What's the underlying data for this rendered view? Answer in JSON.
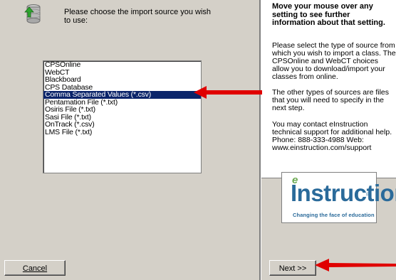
{
  "prompt": {
    "text": "Please choose the import source you wish to use:"
  },
  "source_list": {
    "items": [
      "CPSOnline",
      "WebCT",
      "Blackboard",
      "CPS Database",
      "Comma Separated Values (*.csv)",
      "Pentamation File (*.txt)",
      "Osiris File (*.txt)",
      "Sasi File (*.txt)",
      "OnTrack (*.csv)",
      "LMS File (*.txt)"
    ],
    "selected_index": 4
  },
  "info": {
    "heading": "Move your mouse over any setting to see further information about that setting.",
    "para1": "Please select the type of source from which you wish to import a class. The CPSOnline and WebCT choices allow you to download/import your classes from online.",
    "para2": "The other types of sources are files that you will need to specify in the next step.",
    "para3": "You may contact eInstruction technical support for additional help. Phone: 888-333-4988 Web: www.einstruction.com/support"
  },
  "logo": {
    "e": "e",
    "word": "Instruction",
    "tm": "®",
    "tagline": "Changing the face of education"
  },
  "buttons": {
    "cancel": "Cancel",
    "next": "Next >>"
  },
  "colors": {
    "selection": "#0a246a",
    "arrow": "#e00000",
    "logo_blue": "#2a6a9a"
  }
}
